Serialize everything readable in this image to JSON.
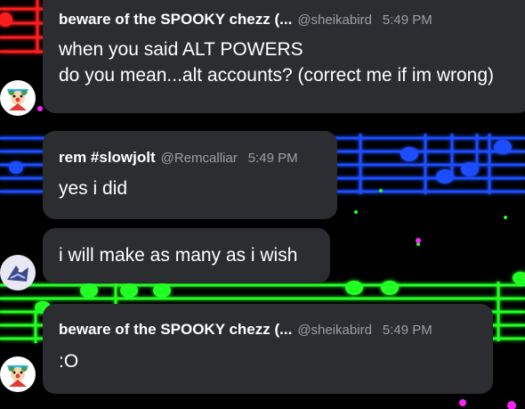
{
  "colors": {
    "bubble": "#2b2d31",
    "text": "#ffffff",
    "muted": "#9aa0a6",
    "staff_red": "#ff1a1a",
    "staff_blue": "#1e4dff",
    "staff_green": "#22ff22",
    "staff_magenta": "#ff22ff"
  },
  "messages": [
    {
      "author": "beware of the SPOOKY chezz (...",
      "handle": "@sheikabird",
      "time": "5:49 PM",
      "lines": [
        "when you said ALT POWERS",
        "do you mean...alt accounts? (correct me if im wrong)"
      ],
      "avatar_icon": "clown-avatar-icon"
    },
    {
      "author": "rem #slowjolt",
      "handle": "@Remcalliar",
      "time": "5:49 PM",
      "lines": [
        "yes i did"
      ]
    },
    {
      "lines": [
        "i will make as many as i wish"
      ],
      "avatar_icon": "shark-avatar-icon"
    },
    {
      "author": "beware of the SPOOKY chezz (...",
      "handle": "@sheikabird",
      "time": "5:49 PM",
      "lines": [
        ":O"
      ],
      "avatar_icon": "clown-avatar-icon"
    }
  ]
}
